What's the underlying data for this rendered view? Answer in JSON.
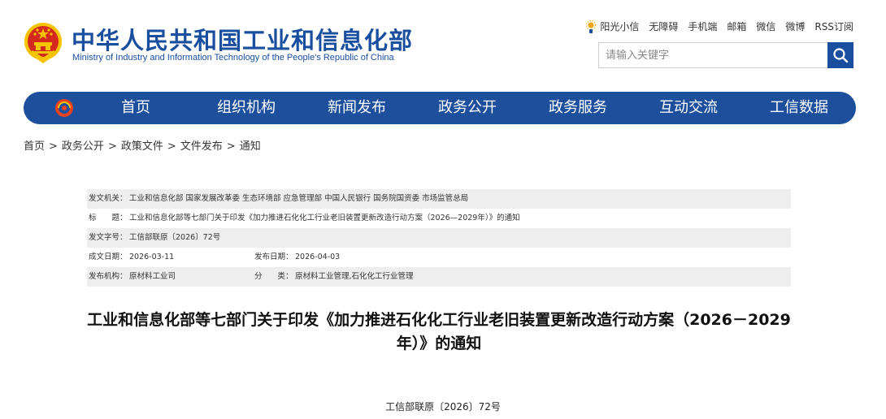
{
  "header": {
    "title": "中华人民共和国工业和信息化部",
    "subtitle": "Ministry of Industry and Information Technology of the People's Republic of China"
  },
  "toplinks": [
    "阳光小信",
    "无障碍",
    "手机端",
    "邮箱",
    "微信",
    "微博",
    "RSS订阅"
  ],
  "search": {
    "placeholder": "请输入关键字"
  },
  "nav": [
    "首页",
    "组织机构",
    "新闻发布",
    "政务公开",
    "政务服务",
    "互动交流",
    "工信数据"
  ],
  "breadcrumb": [
    "首页",
    "政务公开",
    "政策文件",
    "文件发布",
    "通知"
  ],
  "breadcrumb_sep": ">",
  "meta": {
    "issuer_label": "发文机关：",
    "issuer": "工业和信息化部 国家发展改革委 生态环境部 应急管理部 中国人民银行 国务院国资委 市场监管总局",
    "title_label": "标　　题：",
    "title": "工业和信息化部等七部门关于印发《加力推进石化化工行业老旧装置更新改造行动方案（2026—2029年）》的通知",
    "docno_label": "发文字号：",
    "docno": "工信部联原〔2026〕72号",
    "created_label": "成文日期：",
    "created": "2026-03-11",
    "published_label": "发布日期：",
    "published": "2026-04-03",
    "org_label": "发布机构：",
    "org": "原材料工业司",
    "category_label": "分　　类：",
    "category": "原材料工业管理,石化化工行业管理"
  },
  "article": {
    "title": "工业和信息化部等七部门关于印发《加力推进石化化工行业老旧装置更新改造行动方案（2026－2029年）》的通知",
    "doc_number": "工信部联原〔2026〕72号"
  },
  "colors": {
    "brand_blue": "#1d4f9c",
    "title_blue": "#1a4fa0",
    "emblem_red": "#d42a1e",
    "emblem_gold": "#f5c400"
  },
  "icons": {
    "emblem": "national-emblem-icon",
    "sun": "sun-icon",
    "search": "magnifier-icon",
    "nav_logo": "miit-logo-icon"
  }
}
